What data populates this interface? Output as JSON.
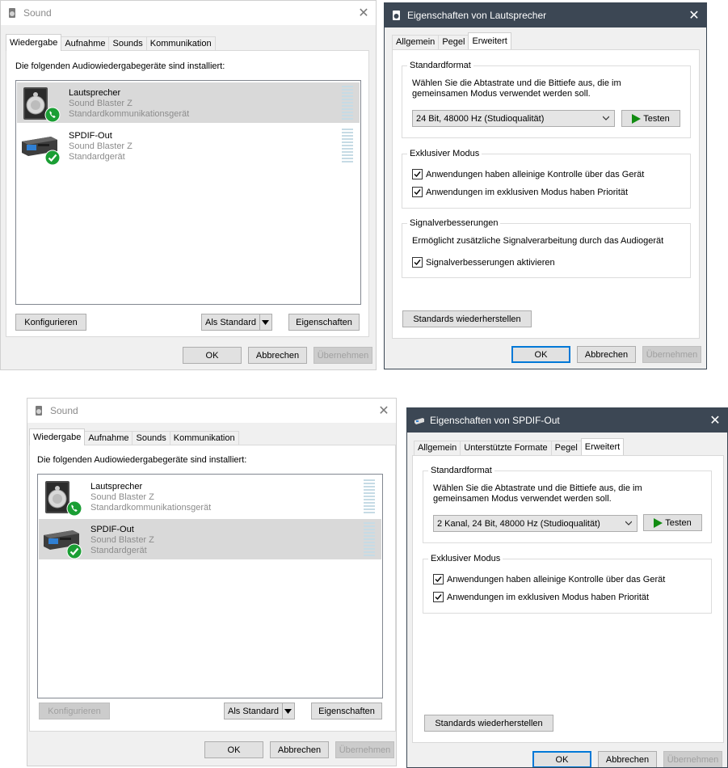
{
  "sound_top": {
    "title": "Sound",
    "tabs": [
      "Wiedergabe",
      "Aufnahme",
      "Sounds",
      "Kommunikation"
    ],
    "intro": "Die folgenden Audiowiedergabegeräte sind installiert:",
    "devices": [
      {
        "name": "Lautsprecher",
        "sub": "Sound Blaster Z",
        "status": "Standardkommunikationsgerät",
        "icon": "speaker-icon",
        "badge": "phone-badge-icon"
      },
      {
        "name": "SPDIF-Out",
        "sub": "Sound Blaster Z",
        "status": "Standardgerät",
        "icon": "spdif-device-icon",
        "badge": "checkmark-badge-icon"
      }
    ],
    "selected_device": "Lautsprecher",
    "configure": "Konfigurieren",
    "set_default": "Als Standard",
    "properties": "Eigenschaften",
    "ok": "OK",
    "cancel": "Abbrechen",
    "apply": "Übernehmen"
  },
  "props_top": {
    "title": "Eigenschaften von Lautsprecher",
    "tabs": [
      "Allgemein",
      "Pegel",
      "Erweitert"
    ],
    "active_tab": "Erweitert",
    "default_format_title": "Standardformat",
    "default_format_desc_1": "Wählen Sie die Abtastrate und die Bittiefe aus, die im",
    "default_format_desc_2": "gemeinsamen Modus verwendet werden soll.",
    "format_value": "24 Bit, 48000 Hz (Studioqualität)",
    "test": "Testen",
    "exclusive_title": "Exklusiver Modus",
    "exclusive_1": "Anwendungen haben alleinige Kontrolle über das Gerät",
    "exclusive_2": "Anwendungen im exklusiven Modus haben Priorität",
    "enh_title": "Signalverbesserungen",
    "enh_desc": "Ermöglicht zusätzliche Signalverarbeitung durch das Audiogerät",
    "enh_check": "Signalverbesserungen aktivieren",
    "restore": "Standards wiederherstellen",
    "ok": "OK",
    "cancel": "Abbrechen",
    "apply": "Übernehmen"
  },
  "sound_bottom": {
    "title": "Sound",
    "tabs": [
      "Wiedergabe",
      "Aufnahme",
      "Sounds",
      "Kommunikation"
    ],
    "intro": "Die folgenden Audiowiedergabegeräte sind installiert:",
    "devices": [
      {
        "name": "Lautsprecher",
        "sub": "Sound Blaster Z",
        "status": "Standardkommunikationsgerät",
        "icon": "speaker-icon",
        "badge": "phone-badge-icon"
      },
      {
        "name": "SPDIF-Out",
        "sub": "Sound Blaster Z",
        "status": "Standardgerät",
        "icon": "spdif-device-icon",
        "badge": "checkmark-badge-icon"
      }
    ],
    "selected_device": "SPDIF-Out",
    "configure": "Konfigurieren",
    "set_default": "Als Standard",
    "properties": "Eigenschaften",
    "ok": "OK",
    "cancel": "Abbrechen",
    "apply": "Übernehmen"
  },
  "props_bottom": {
    "title": "Eigenschaften von SPDIF-Out",
    "tabs": [
      "Allgemein",
      "Unterstützte Formate",
      "Pegel",
      "Erweitert"
    ],
    "active_tab": "Erweitert",
    "default_format_title": "Standardformat",
    "default_format_desc_1": "Wählen Sie die Abtastrate und die Bittiefe aus, die im",
    "default_format_desc_2": "gemeinsamen Modus verwendet werden soll.",
    "format_value": "2 Kanal, 24 Bit, 48000 Hz (Studioqualität)",
    "test": "Testen",
    "exclusive_title": "Exklusiver Modus",
    "exclusive_1": "Anwendungen haben alleinige Kontrolle über das Gerät",
    "exclusive_2": "Anwendungen im exklusiven Modus haben Priorität",
    "restore": "Standards wiederherstellen",
    "ok": "OK",
    "cancel": "Abbrechen",
    "apply": "Übernehmen"
  },
  "colors": {
    "props_titlebar": "#3c4754",
    "selection": "#d9d9d9",
    "focus_border": "#0078d7",
    "badge_green": "#1a9e34",
    "play_green": "#128c12"
  }
}
